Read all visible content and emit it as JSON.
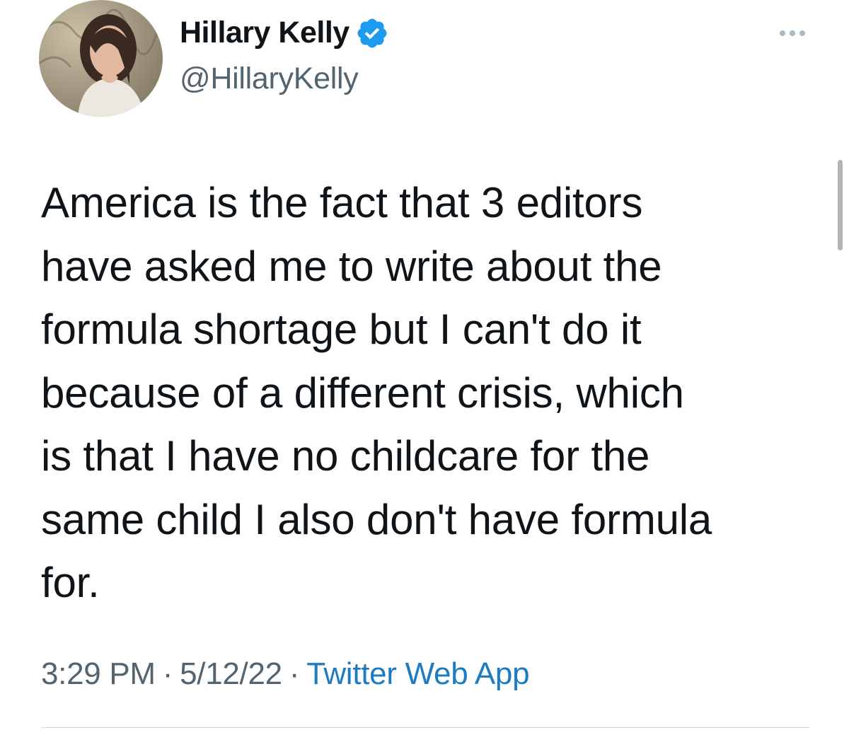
{
  "author": {
    "display_name": "Hillary Kelly",
    "handle": "@HillaryKelly",
    "verified": true,
    "avatar_icon": "profile-photo"
  },
  "tweet": {
    "text": "America is the fact that 3 editors\nhave asked me to write about the\nformula shortage but I can't do it\nbecause of a different crisis, which\nis that I have no childcare for the\nsame child I also don't have formula\nfor."
  },
  "meta": {
    "time": "3:29 PM",
    "separator": "·",
    "date": "5/12/22",
    "source": "Twitter Web App"
  },
  "colors": {
    "verified_badge": "#1d9bf0",
    "source_link": "#1d7bc2",
    "secondary_text": "#536471"
  }
}
